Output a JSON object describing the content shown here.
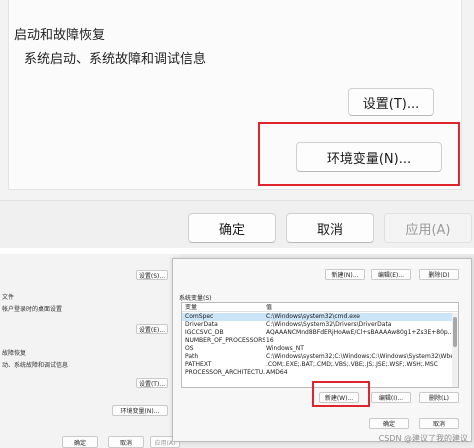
{
  "top_panel": {
    "group_title": "启动和故障恢复",
    "group_desc": "系统启动、系统故障和调试信息",
    "settings_button": "设置(T)...",
    "env_button": "环境变量(N)...",
    "ok": "确定",
    "cancel": "取消",
    "apply": "应用(A)"
  },
  "bg_dialog": {
    "labels": [
      "文件",
      "帐户登录时的桌面设置",
      "故障恢复",
      "动、系统故障和调试信息"
    ],
    "settings1": "设置(S)...",
    "settings2": "设置(E)...",
    "settings3": "设置(T)...",
    "env_button": "环境变量(N)...",
    "ok": "确定",
    "cancel": "取消",
    "apply": "应用(A)"
  },
  "env_dialog": {
    "user_new": "新建(N)...",
    "user_edit": "编辑(E)...",
    "user_delete": "删除(D)",
    "system_label": "系统变量(S)",
    "columns": [
      "变量",
      "值"
    ],
    "rows": [
      {
        "name": "ComSpec",
        "value": "C:\\Windows\\system32\\cmd.exe"
      },
      {
        "name": "DriverData",
        "value": "C:\\Windows\\System32\\Drivers\\DriverData"
      },
      {
        "name": "IGCCSVC_DB",
        "value": "AQAAANCMnd8BFdERjHoAwE/Cl+sBAAAAw80g1+Zs3E+80p..."
      },
      {
        "name": "NUMBER_OF_PROCESSORS",
        "value": "16"
      },
      {
        "name": "OS",
        "value": "Windows_NT"
      },
      {
        "name": "Path",
        "value": "C:\\Windows\\system32;C:\\Windows;C:\\Windows\\System32\\Wbe..."
      },
      {
        "name": "PATHEXT",
        "value": ".COM;.EXE;.BAT;.CMD;.VBS;.VBE;.JS;.JSE;.WSF;.WSH;.MSC"
      },
      {
        "name": "PROCESSOR_ARCHITECTU...",
        "value": "AMD64"
      }
    ],
    "sys_new": "新建(W)...",
    "sys_edit": "编辑(I)...",
    "sys_delete": "删除(L)",
    "ok": "确定",
    "cancel": "取消"
  },
  "watermark": "CSDN @建议了我的建议",
  "colors": {
    "highlight": "#e0242e",
    "selection": "#cce4f7"
  }
}
